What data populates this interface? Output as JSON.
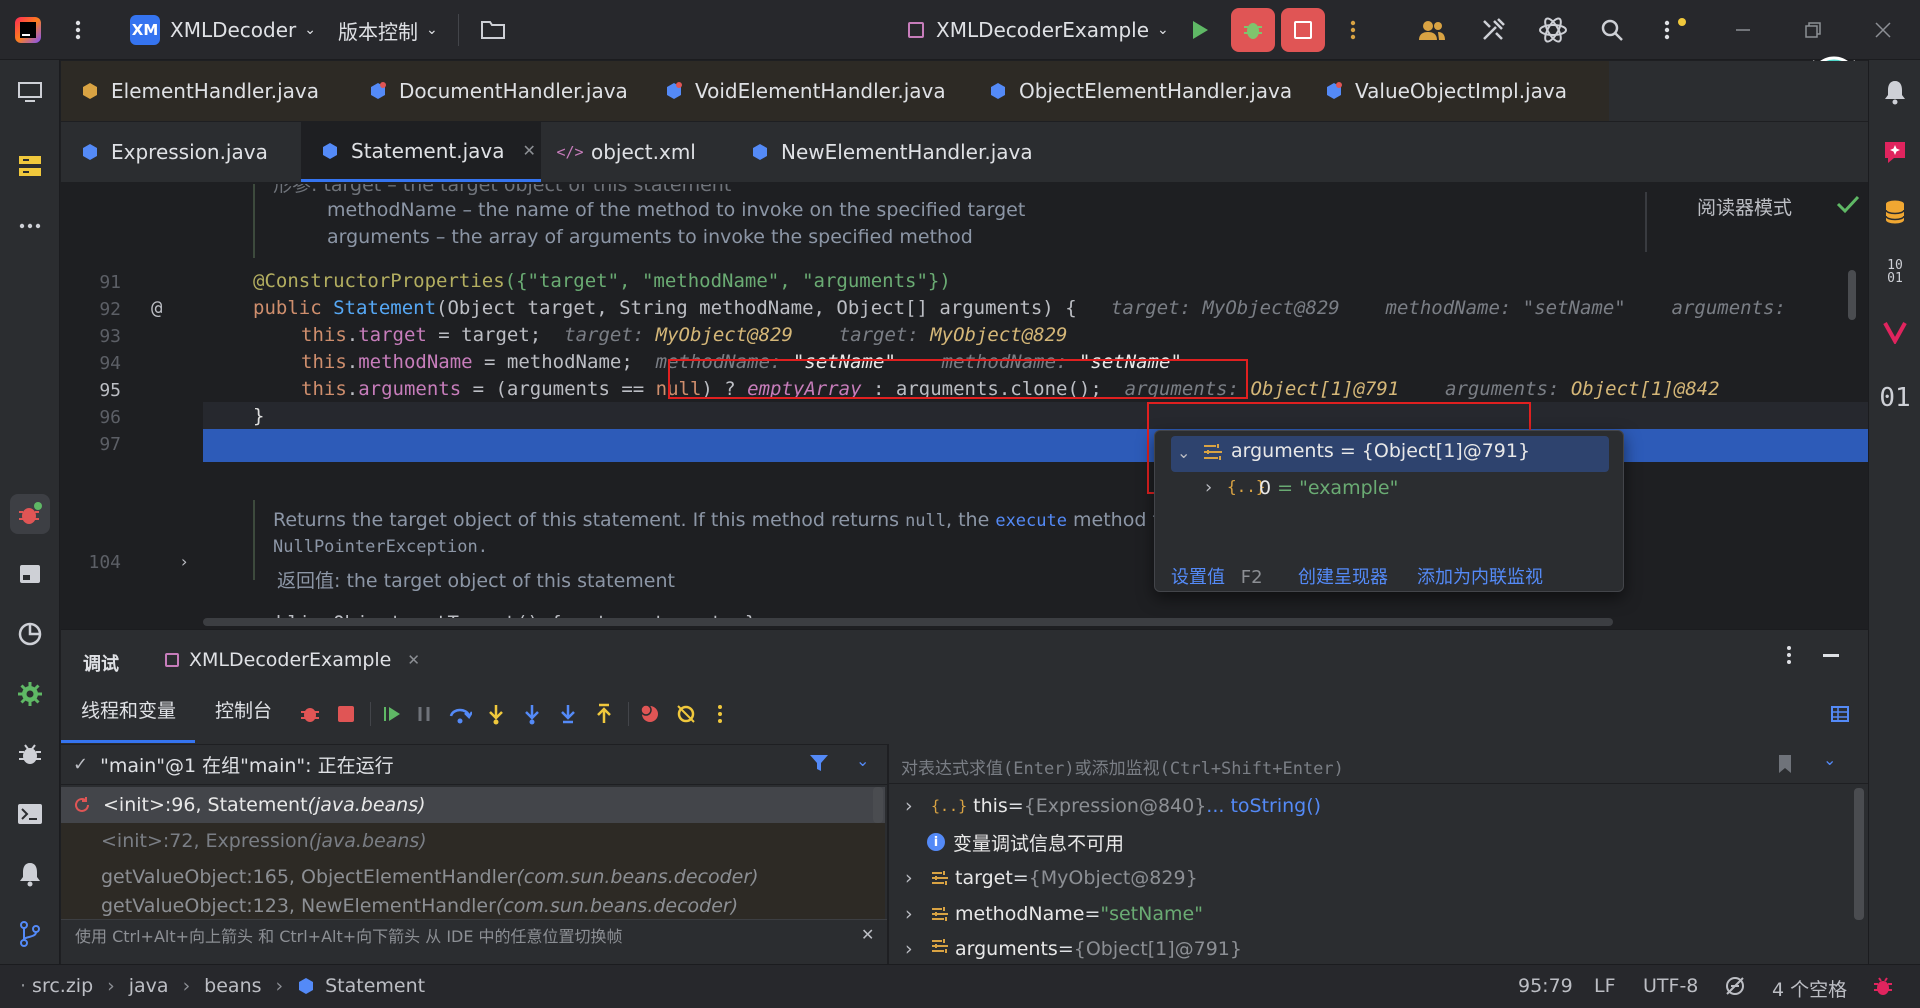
{
  "titlebar": {
    "project_badge": "XM",
    "project_name": "XMLDecoder",
    "vcs_label": "版本控制",
    "run_config": "XMLDecoderExample"
  },
  "tabs_row1": [
    {
      "label": "ElementHandler.java"
    },
    {
      "label": "DocumentHandler.java"
    },
    {
      "label": "VoidElementHandler.java"
    },
    {
      "label": "ObjectElementHandler.java"
    },
    {
      "label": "ValueObjectImpl.java"
    }
  ],
  "tabs_row2": [
    {
      "label": "Expression.java"
    },
    {
      "label": "Statement.java"
    },
    {
      "label": "object.xml"
    },
    {
      "label": "NewElementHandler.java"
    }
  ],
  "editor": {
    "reader_mode": "阅读器模式",
    "doc_top_line0": "形参: target – the target object of this statement",
    "doc_top_line1": "methodName – the name of the method to invoke on the specified target",
    "doc_top_line2": "arguments – the array of arguments to invoke the specified method",
    "line_numbers": [
      "91",
      "92",
      "93",
      "94",
      "95",
      "96",
      "97",
      "104"
    ],
    "l91": {
      "ann": "@ConstructorProperties",
      "args": "({\"target\", \"methodName\", \"arguments\"})"
    },
    "l92": {
      "kw": "public",
      "name": "Statement",
      "params": "(Object target, String methodName, Object[] arguments) {",
      "h1": "target: MyObject@829",
      "h2": "methodName: \"setName\"",
      "h3": "arguments:"
    },
    "l93": {
      "this": "this",
      "field": "target",
      "rest": " = target;",
      "h1k": "target: ",
      "h1v": "MyObject@829",
      "h2k": "target: ",
      "h2v": "MyObject@829"
    },
    "l94": {
      "this": "this",
      "field": "methodName",
      "rest": " = methodName;",
      "h1k": "methodName: ",
      "h1v": "\"setName\"",
      "h2k": "methodName: ",
      "h2v": "\"setName\""
    },
    "l95": {
      "this": "this",
      "field": "arguments",
      "mid": " = (arguments == ",
      "null": "null",
      "tern": ") ? ",
      "empty": "emptyArray",
      "rest": " : arguments.clone();",
      "h1k": "arguments: ",
      "h1v": "Object[1]@791",
      "h2k": "arguments: ",
      "h2v": "Object[1]@842"
    },
    "l96": "}",
    "doc_mid_line1_a": "Returns the target object of this statement. If this method returns ",
    "doc_mid_line1_code": "null",
    "doc_mid_line1_b": ", the ",
    "doc_mid_line1_code2": "execute",
    "doc_mid_line1_c": " method thro",
    "doc_mid_line2": "NullPointerException.",
    "doc_mid_line3": "返回值: the target object of this statement",
    "l104": "public Object getTarget() { return target; }"
  },
  "popup": {
    "root": "arguments = {Object[1]@791}",
    "child_key": "0",
    "child_value": " = \"example\"",
    "link_set": "设置值",
    "link_set_key": "F2",
    "link_renderer": "创建呈现器",
    "link_watch": "添加为内联监视"
  },
  "debug": {
    "title": "调试",
    "session": "XMLDecoderExample",
    "tab_threads": "线程和变量",
    "tab_console": "控制台",
    "thread": "\"main\"@1 在组\"main\": 正在运行",
    "frames": [
      {
        "method": "<init>:96, Statement ",
        "pkg": "(java.beans)"
      },
      {
        "method": "<init>:72, Expression ",
        "pkg": "(java.beans)"
      },
      {
        "method": "getValueObject:165, ObjectElementHandler ",
        "pkg": "(com.sun.beans.decoder)"
      },
      {
        "method": "getValueObject:123, NewElementHandler ",
        "pkg": "(com.sun.beans.decoder)"
      }
    ],
    "frames_hint": "使用 Ctrl+Alt+向上箭头 和 Ctrl+Alt+向下箭头 从 IDE 中的任意位置切换帧",
    "eval_placeholder": "对表达式求值(Enter)或添加监视(Ctrl+Shift+Enter)",
    "vars": [
      {
        "name": "this",
        "eq": " = ",
        "val": "{Expression@840}",
        "extra": " ... toString()"
      },
      {
        "info": "变量调试信息不可用"
      },
      {
        "name": "target",
        "eq": " = ",
        "val": "{MyObject@829}"
      },
      {
        "name": "methodName",
        "eq": " = ",
        "val": "\"setName\""
      },
      {
        "name": "arguments",
        "eq": " = ",
        "val": "{Object[1]@791}"
      }
    ]
  },
  "statusbar": {
    "crumbs": [
      "src.zip",
      "java",
      "beans",
      "Statement"
    ],
    "position": "95:79",
    "line_sep": "LF",
    "encoding": "UTF-8",
    "indent": "4 个空格"
  },
  "colors": {
    "accent": "#3574f0",
    "bg_editor": "#1e1f22",
    "bg_panel": "#2b2d30",
    "highlight_line": "#2d5bb8",
    "red_box": "#e02020"
  }
}
